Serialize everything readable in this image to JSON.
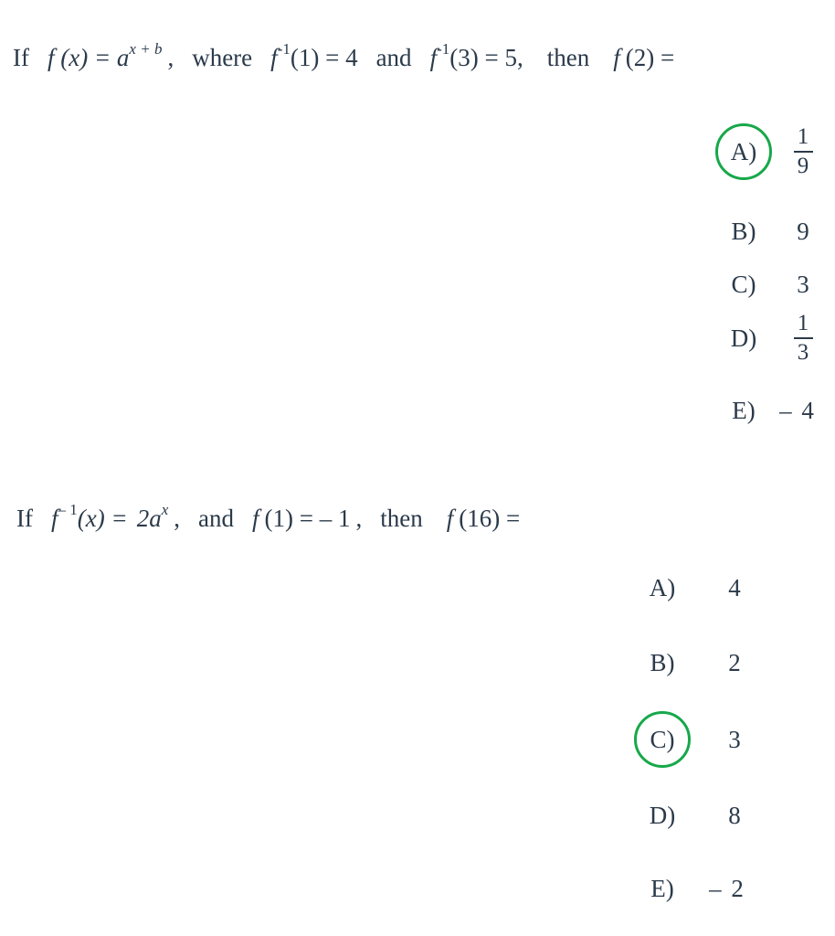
{
  "page": {
    "background_color": "#ffffff",
    "text_color": "#2b3a4a",
    "highlight_color": "#17a84a"
  },
  "questions": [
    {
      "id": "question-1",
      "prompt_parts": {
        "if": "If",
        "function_def": "f (x) = a",
        "exponent": "x + b",
        "comma": ",",
        "where": "where",
        "cond1_f": "f",
        "cond1_sup": "-1",
        "cond1_rest": "(1) = 4",
        "and": "and",
        "cond2_f": "f",
        "cond2_sup": "-1",
        "cond2_rest": "(3) = 5",
        "comma2": ",",
        "then": "then",
        "target_f": "f",
        "target_rest": "(2)  ="
      },
      "plain_text": "If f(x) = a^(x+b), where f^-1(1) = 4 and f^-1(3) = 5, then f(2) =",
      "options": [
        {
          "label": "A)",
          "value_type": "fraction",
          "numerator": "1",
          "denominator": "9",
          "value": "1/9",
          "circled": true
        },
        {
          "label": "B)",
          "value_type": "plain",
          "value": "9",
          "circled": false
        },
        {
          "label": "C)",
          "value_type": "plain",
          "value": "3",
          "circled": false
        },
        {
          "label": "D)",
          "value_type": "fraction",
          "numerator": "1",
          "denominator": "3",
          "value": "1/3",
          "circled": false
        },
        {
          "label": "E)",
          "value_type": "plain",
          "value": "– 4",
          "circled": false
        }
      ]
    },
    {
      "id": "question-2",
      "prompt_parts": {
        "if": "If",
        "inv_f": "f",
        "inv_sup": "– 1",
        "inv_rest": "(x) =",
        "rhs": "2a",
        "rhs_sup": "x",
        "comma": ",",
        "and": "and",
        "cond_f": "f",
        "cond_rest": "(1) = – 1",
        "comma2": ",",
        "then": "then",
        "target_f": "f",
        "target_rest": "(16)  ="
      },
      "plain_text": "If f^-1(x) = 2a^x, and f(1) = -1, then f(16) =",
      "options": [
        {
          "label": "A)",
          "value_type": "plain",
          "value": "4",
          "circled": false
        },
        {
          "label": "B)",
          "value_type": "plain",
          "value": "2",
          "circled": false
        },
        {
          "label": "C)",
          "value_type": "plain",
          "value": "3",
          "circled": true
        },
        {
          "label": "D)",
          "value_type": "plain",
          "value": "8",
          "circled": false
        },
        {
          "label": "E)",
          "value_type": "plain",
          "value": "– 2",
          "circled": false
        }
      ]
    }
  ]
}
